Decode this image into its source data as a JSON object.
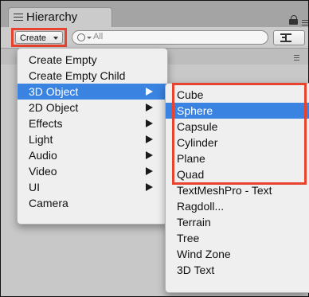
{
  "window": {
    "tab_title": "Hierarchy"
  },
  "toolbar": {
    "create_label": "Create",
    "search_placeholder": "All"
  },
  "create_menu": {
    "items": [
      {
        "label": "Create Empty",
        "has_submenu": false
      },
      {
        "label": "Create Empty Child",
        "has_submenu": false
      },
      {
        "label": "3D Object",
        "has_submenu": true,
        "selected": true
      },
      {
        "label": "2D Object",
        "has_submenu": true
      },
      {
        "label": "Effects",
        "has_submenu": true
      },
      {
        "label": "Light",
        "has_submenu": true
      },
      {
        "label": "Audio",
        "has_submenu": true
      },
      {
        "label": "Video",
        "has_submenu": true
      },
      {
        "label": "UI",
        "has_submenu": true
      },
      {
        "label": "Camera",
        "has_submenu": false
      }
    ]
  },
  "submenu_3d_object": {
    "items": [
      {
        "label": "Cube"
      },
      {
        "label": "Sphere",
        "selected": true
      },
      {
        "label": "Capsule"
      },
      {
        "label": "Cylinder"
      },
      {
        "label": "Plane"
      },
      {
        "label": "Quad"
      },
      {
        "label": "TextMeshPro - Text"
      },
      {
        "label": "Ragdoll..."
      },
      {
        "label": "Terrain"
      },
      {
        "label": "Tree"
      },
      {
        "label": "Wind Zone"
      },
      {
        "label": "3D Text"
      }
    ]
  },
  "colors": {
    "selection": "#3a83e0",
    "annotation_highlight": "#e8432f",
    "panel_background": "#c8c8c8"
  },
  "icons": {
    "tab_icon": "hierarchy-list-icon",
    "lock": "lock-icon",
    "search": "search-icon",
    "filter": "filter-icon",
    "submenu_arrow": "triangle-right-icon"
  }
}
